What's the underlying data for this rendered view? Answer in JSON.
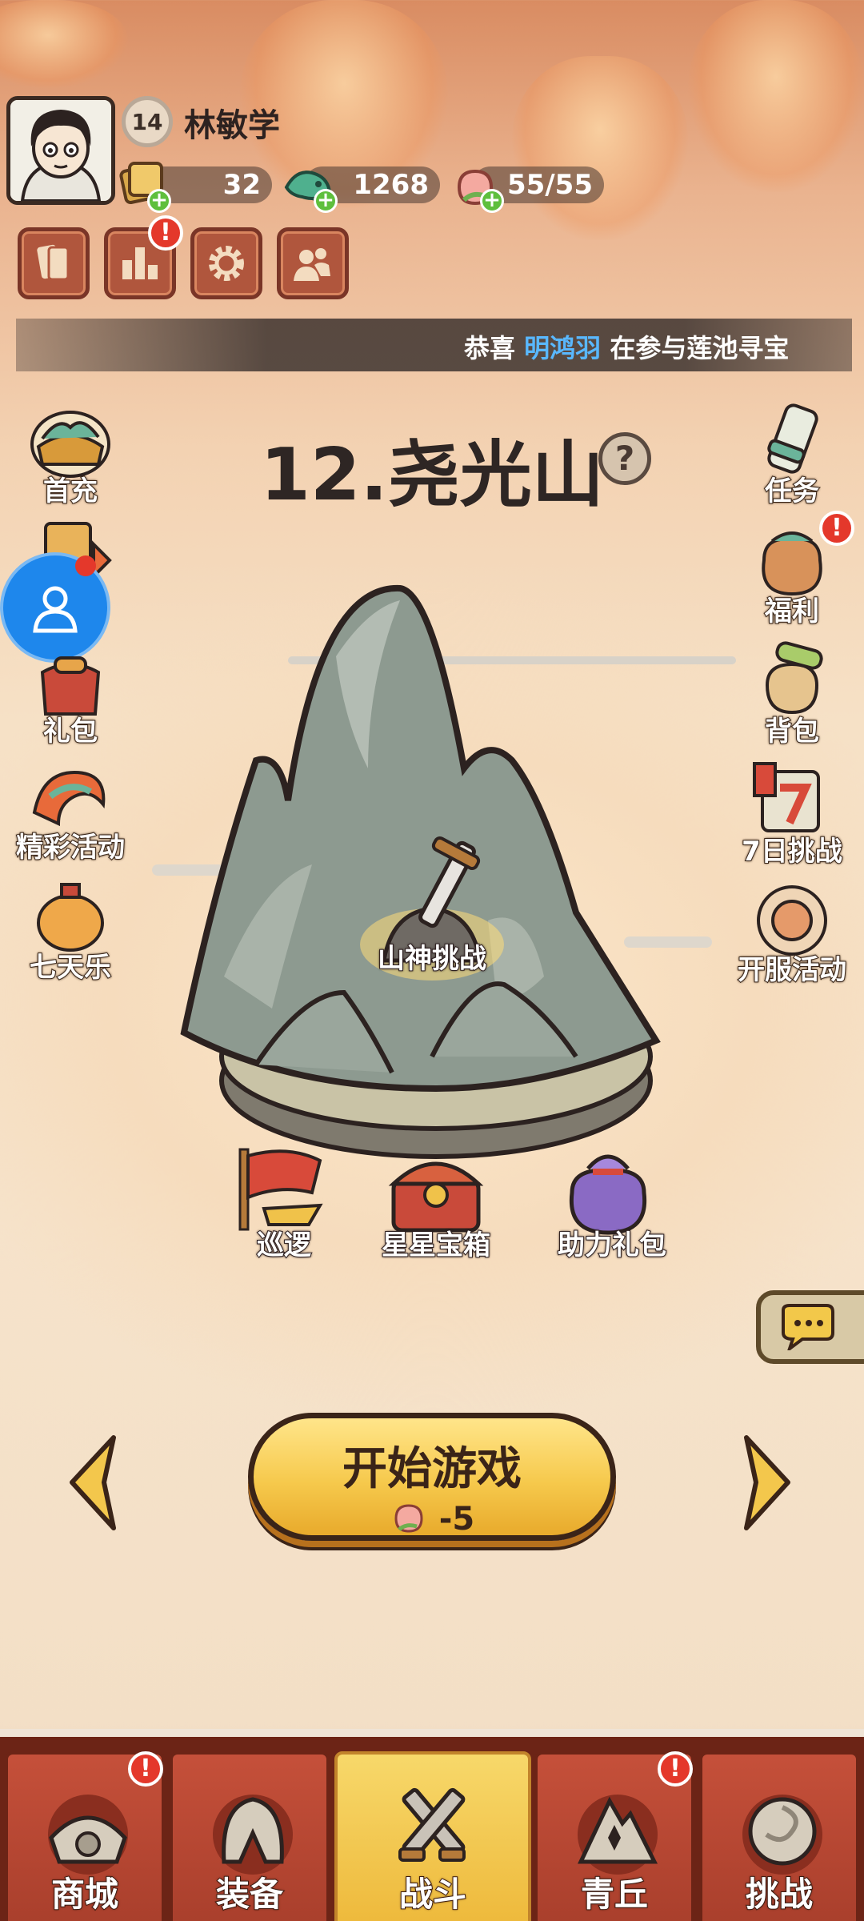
{
  "player": {
    "level": "14",
    "name": "林敏学"
  },
  "resources": {
    "tickets": "32",
    "jade": "1268",
    "stamina": "55/55"
  },
  "toolbar": {
    "alert_badge": "!"
  },
  "ticker": {
    "prefix": "恭喜 ",
    "highlight": "明鸿羽",
    "suffix": " 在参与莲池寻宝"
  },
  "left_menu": [
    "首充",
    "礼包",
    "精彩活动",
    "七天乐"
  ],
  "right_menu": [
    "任务",
    "福利",
    "背包",
    "7日挑战",
    "开服活动"
  ],
  "stage": {
    "title": "12.尧光山",
    "help": "?",
    "boss_label": "山神挑战"
  },
  "stage_items": [
    "巡逻",
    "星星宝箱",
    "助力礼包"
  ],
  "start_button": {
    "label": "开始游戏",
    "cost": "-5"
  },
  "bottom_nav": {
    "items": [
      "商城",
      "装备",
      "战斗",
      "青丘",
      "挑战"
    ],
    "active": "战斗"
  },
  "colors": {
    "accent_gold": "#f6c94c",
    "nav_red": "#a93f2c",
    "badge_red": "#e4382b",
    "highlight_blue": "#59b8ff"
  }
}
